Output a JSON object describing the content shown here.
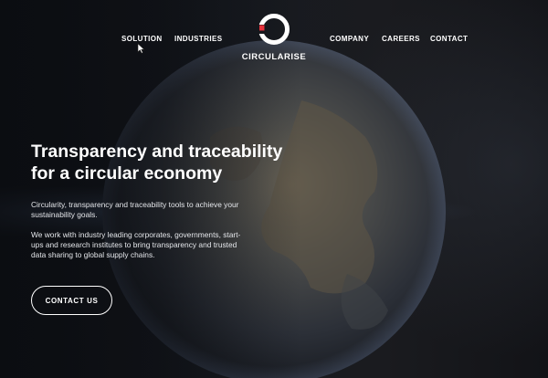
{
  "header": {
    "nav_left": [
      {
        "label": "SOLUTION"
      },
      {
        "label": "INDUSTRIES"
      }
    ],
    "logo_text": "CIRCULARISE",
    "nav_right": [
      {
        "label": "COMPANY"
      },
      {
        "label": "CAREERS"
      },
      {
        "label": "CONTACT"
      }
    ]
  },
  "hero": {
    "title_line1": "Transparency and traceability",
    "title_line2": "for a circular economy",
    "paragraph1": "Circularity, transparency and traceability tools to achieve your sustainability goals.",
    "paragraph2": "We work with industry leading corporates, governments, start-ups and research institutes to bring transparency and trusted data sharing to global supply chains.",
    "cta_label": "CONTACT US"
  },
  "colors": {
    "background": "#15171c",
    "text": "#ffffff",
    "logo_accent": "#e8323c"
  },
  "icons": {
    "logo": "circularise-logo-icon",
    "cursor": "mouse-pointer-icon"
  }
}
